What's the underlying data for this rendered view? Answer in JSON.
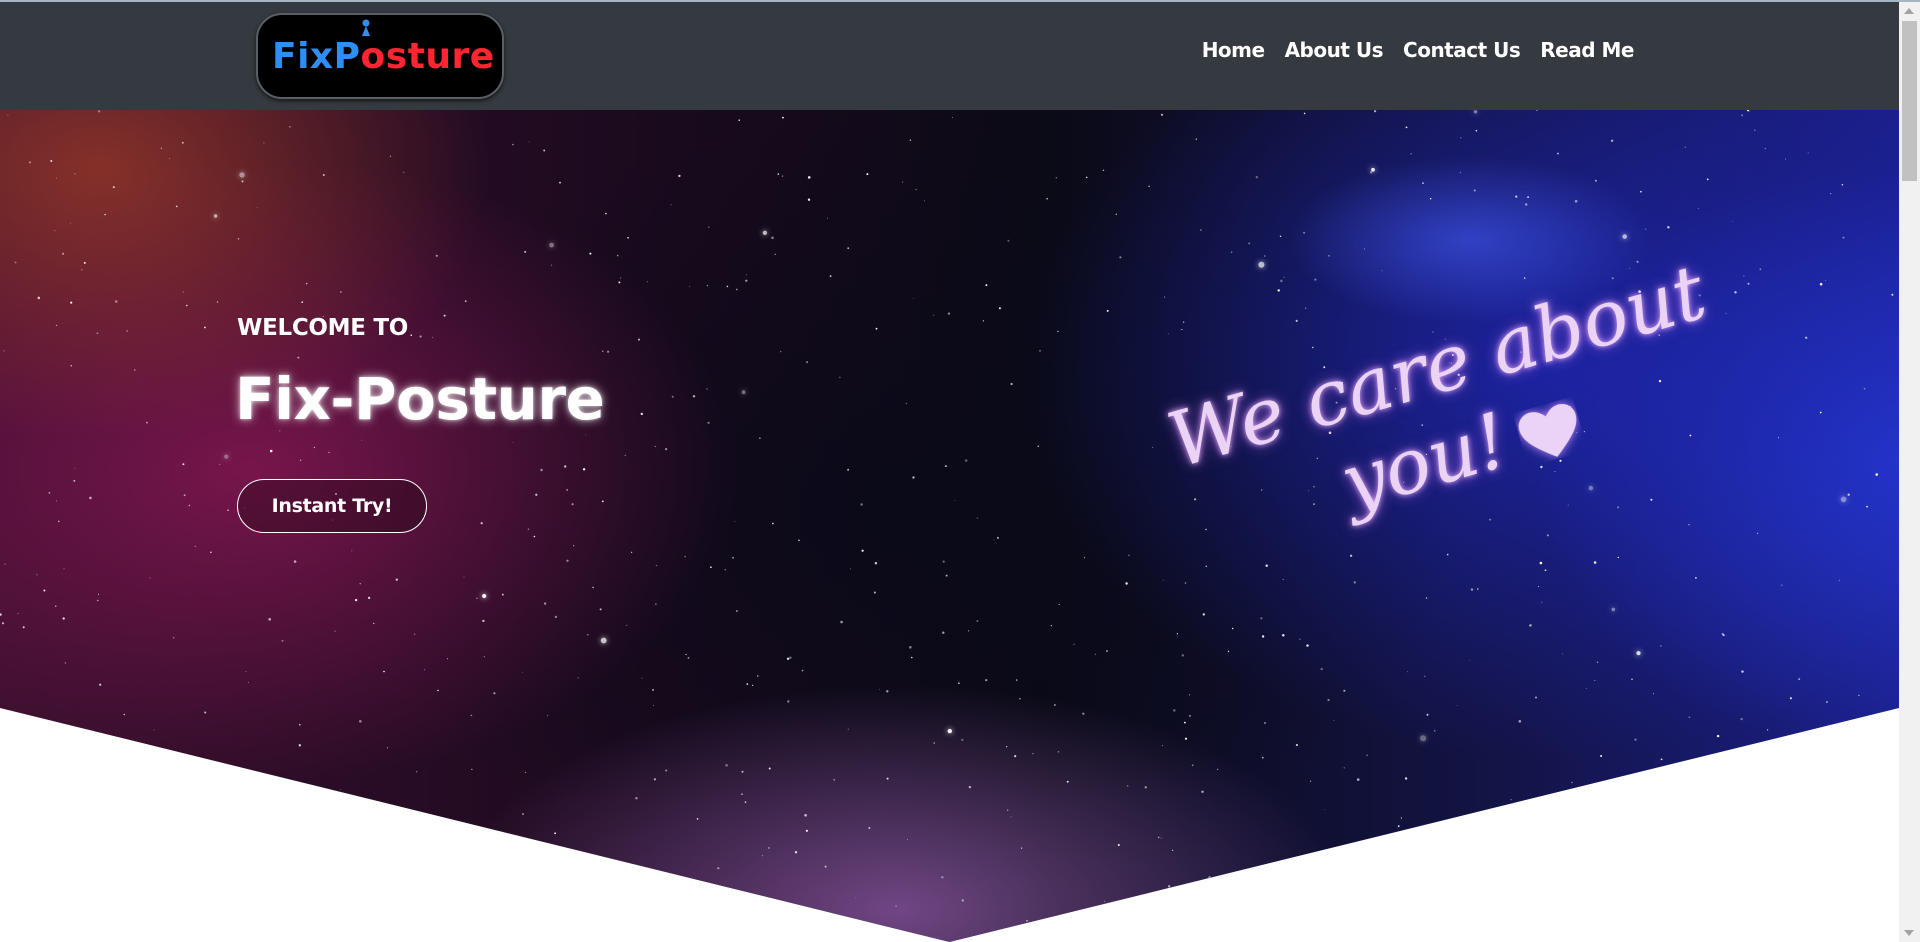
{
  "header": {
    "logo": {
      "part1": "Fix",
      "part2": "P",
      "part3": "sture"
    },
    "nav": [
      {
        "label": "Home"
      },
      {
        "label": "About Us"
      },
      {
        "label": "Contact Us"
      },
      {
        "label": "Read Me"
      }
    ]
  },
  "hero": {
    "welcome": "WELCOME TO",
    "title": "Fix-Posture",
    "cta_label": "Instant Try!",
    "script_line1": "We care about",
    "script_line2": "you!",
    "heart_icon": "heart-icon"
  },
  "colors": {
    "navbar_bg": "#343a40",
    "logo_blue": "#2f8ef2",
    "logo_red": "#ff2631",
    "script_color": "#ead3f4"
  }
}
